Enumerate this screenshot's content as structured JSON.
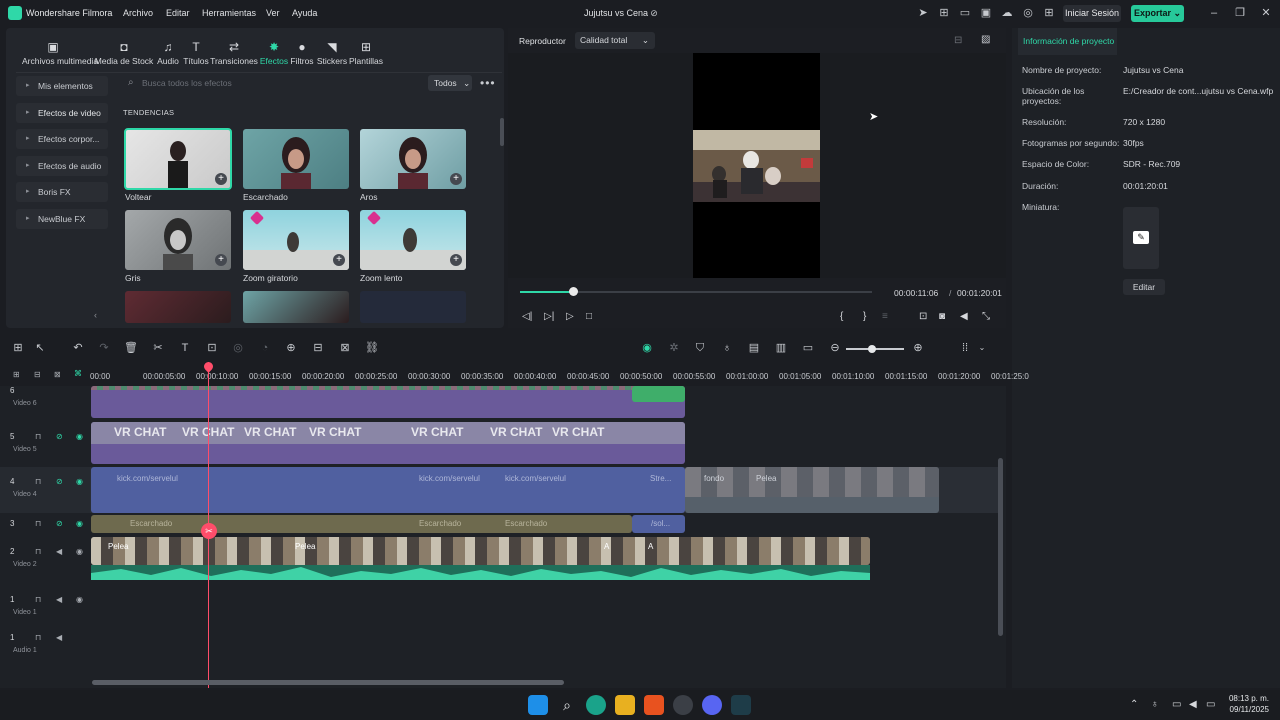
{
  "app": {
    "name": "Wondershare Filmora",
    "project_title": "Jujutsu vs Cena"
  },
  "menu": [
    "Archivo",
    "Editar",
    "Herramientas",
    "Ver",
    "Ayuda"
  ],
  "header_buttons": {
    "login": "Iniciar Sesión",
    "export": "Exportar"
  },
  "tool_tabs": [
    "Archivos multimedia",
    "Media de Stock",
    "Audio",
    "Títulos",
    "Transiciones",
    "Efectos",
    "Filtros",
    "Stickers",
    "Plantillas"
  ],
  "active_tab": "Efectos",
  "sidebar": [
    "Mis elementos",
    "Efectos de video",
    "Efectos corpor...",
    "Efectos de audio",
    "Boris FX",
    "NewBlue FX"
  ],
  "search": {
    "placeholder": "Busca todos los efectos",
    "filter": "Todos"
  },
  "section_title": "TENDENCIAS",
  "effects": [
    {
      "label": "Voltear"
    },
    {
      "label": "Escarchado"
    },
    {
      "label": "Aros"
    },
    {
      "label": "Gris"
    },
    {
      "label": "Zoom giratorio"
    },
    {
      "label": "Zoom lento"
    }
  ],
  "player": {
    "tab": "Reproductor",
    "quality": "Calidad total",
    "current_time": "00:00:11:06",
    "separator": "/",
    "total_time": "00:01:20:01",
    "progress": 0.15
  },
  "project_info": {
    "tab": "Información de proyecto",
    "fields": [
      {
        "key": "Nombre de proyecto:",
        "value": "Jujutsu vs Cena"
      },
      {
        "key": "Ubicación de los proyectos:",
        "value": "E:/Creador de cont...ujutsu vs Cena.wfp"
      },
      {
        "key": "Resolución:",
        "value": "720 x 1280"
      },
      {
        "key": "Fotogramas por segundo:",
        "value": "30fps"
      },
      {
        "key": "Espacio de Color:",
        "value": "SDR - Rec.709"
      },
      {
        "key": "Duración:",
        "value": "00:01:20:01"
      },
      {
        "key": "Miniatura:",
        "value": ""
      }
    ],
    "edit_button": "Editar"
  },
  "ruler_ticks": [
    "00:00",
    "00:00:05:00",
    "00:00:10:00",
    "00:00:15:00",
    "00:00:20:00",
    "00:00:25:00",
    "00:00:30:00",
    "00:00:35:00",
    "00:00:40:00",
    "00:00:45:00",
    "00:00:50:00",
    "00:00:55:00",
    "00:01:00:00",
    "00:01:05:00",
    "00:01:10:00",
    "00:01:15:00",
    "00:01:20:00",
    "00:01:25:0"
  ],
  "tracks": [
    {
      "num": "6",
      "name": "Video 6"
    },
    {
      "num": "5",
      "name": "Video 5"
    },
    {
      "num": "4",
      "name": "Video 4"
    },
    {
      "num": "3",
      "name": "Video 3"
    },
    {
      "num": "2",
      "name": "Video 2"
    },
    {
      "num": "1",
      "name": "Video 1"
    },
    {
      "num": "1",
      "name": "Audio 1"
    }
  ],
  "clip_texts": {
    "vrchat": "VR CHAT",
    "kick": "kick.com/servelul",
    "stre": "Stre...",
    "escarchado": "Escarchado",
    "sol": "/sol...",
    "pelea": "Pelea",
    "a": "A",
    "pelea_faded": "Pelea",
    "fondo": "fondo"
  },
  "taskbar": {
    "time": "08:13 p. m.",
    "date": "09/11/2025"
  }
}
